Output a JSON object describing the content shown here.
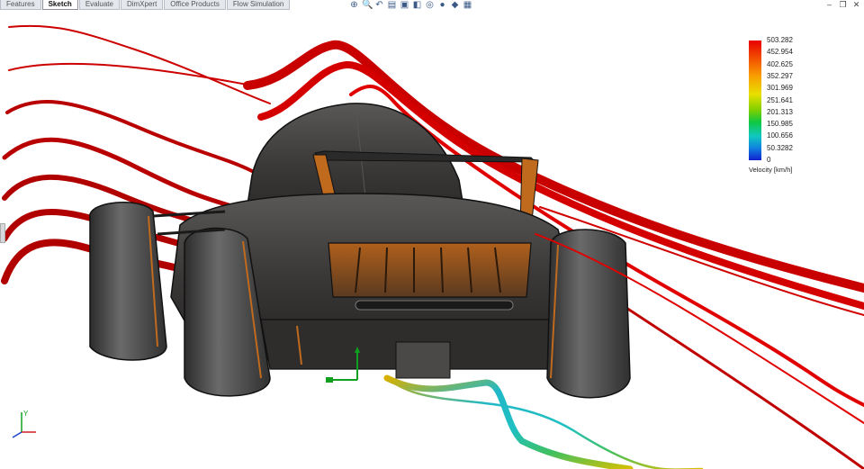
{
  "tabs": [
    {
      "label": "Features",
      "active": false
    },
    {
      "label": "Sketch",
      "active": true
    },
    {
      "label": "Evaluate",
      "active": false
    },
    {
      "label": "DimXpert",
      "active": false
    },
    {
      "label": "Office Products",
      "active": false
    },
    {
      "label": "Flow Simulation",
      "active": false
    }
  ],
  "view_toolbar": [
    {
      "name": "zoom-to-fit-icon",
      "glyph": "⊕"
    },
    {
      "name": "zoom-to-area-icon",
      "glyph": "🔍"
    },
    {
      "name": "previous-view-icon",
      "glyph": "↶"
    },
    {
      "name": "section-view-icon",
      "glyph": "▤"
    },
    {
      "name": "view-orientation-icon",
      "glyph": "▣"
    },
    {
      "name": "display-style-icon",
      "glyph": "◧"
    },
    {
      "name": "hide-show-items-icon",
      "glyph": "◎"
    },
    {
      "name": "edit-appearance-icon",
      "glyph": "●"
    },
    {
      "name": "apply-scene-icon",
      "glyph": "◆"
    },
    {
      "name": "view-settings-icon",
      "glyph": "▦"
    }
  ],
  "window_controls": {
    "minimize": "–",
    "restore": "❐",
    "close": "✕"
  },
  "legend": {
    "values": [
      "503.282",
      "452.954",
      "402.625",
      "352.297",
      "301.969",
      "251.641",
      "201.313",
      "150.985",
      "100.656",
      "50.3282",
      "0"
    ],
    "label": "Velocity [km/h]"
  },
  "colors": {
    "flow_high": "#d80000",
    "flow_low": "#1a40d0",
    "car_body": "#3c3a3a",
    "car_accent": "#c06a1e",
    "triad_x": "#d02020",
    "triad_y": "#10a020",
    "triad_z": "#2040d0"
  }
}
